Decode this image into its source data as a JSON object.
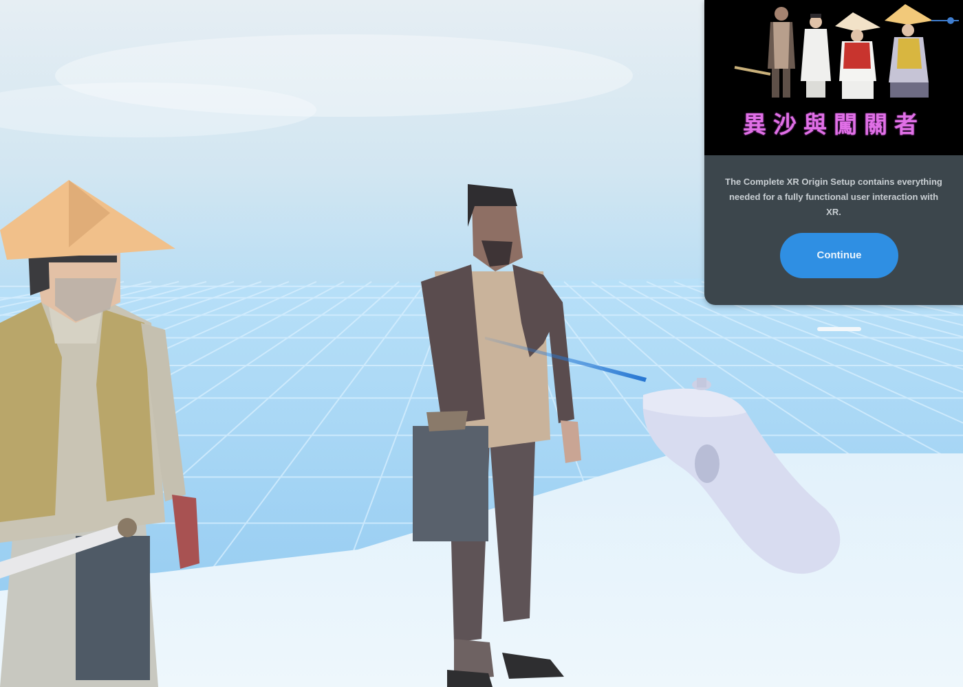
{
  "scene": {
    "type": "vr-environment",
    "colors": {
      "sky_top": "#d8e4ec",
      "sky_horizon": "#a8d6f2",
      "floor_grid": "#9fd0f2",
      "platform": "#e4f2fb",
      "ray": "#2f7fd6"
    },
    "characters": [
      {
        "icon": "conical-hat-villager-icon"
      },
      {
        "icon": "standing-villager-icon"
      }
    ],
    "controller_icon": "vr-controller-icon"
  },
  "xr_panel": {
    "banner": {
      "title": "異沙與闖關者",
      "figures_icon": "villager-group-icon"
    },
    "body_text": "The Complete XR Origin Setup contains everything needed for a fully functional user interaction with XR.",
    "continue_label": "Continue"
  }
}
